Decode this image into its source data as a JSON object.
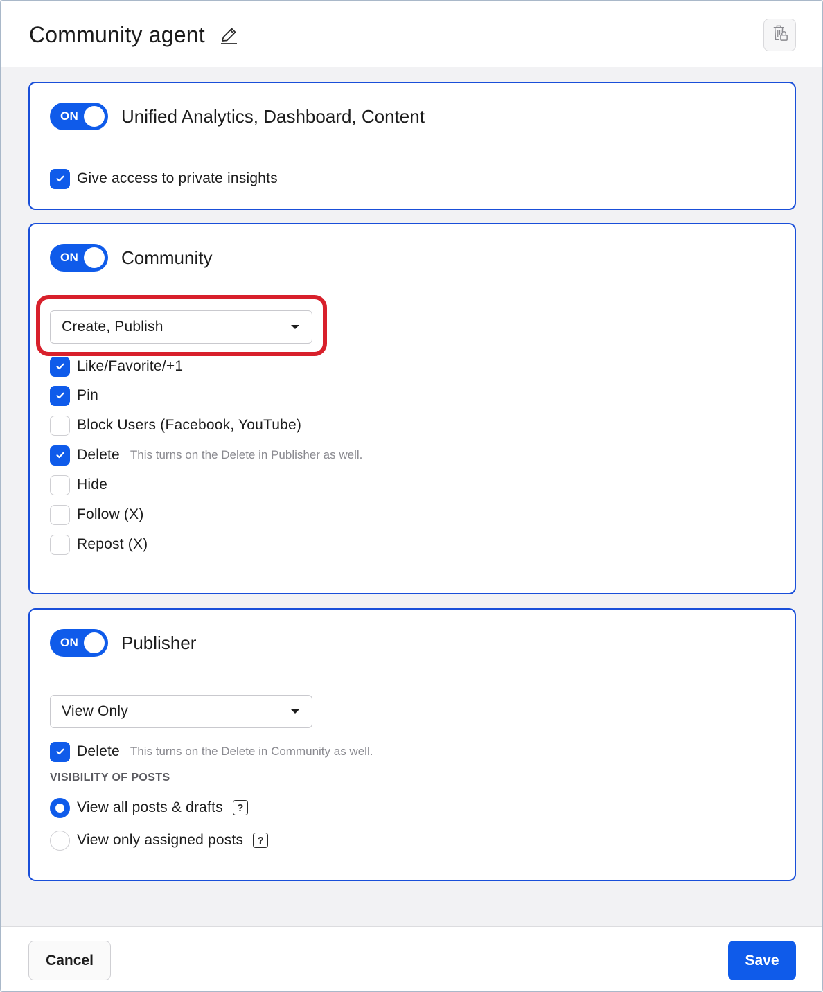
{
  "header": {
    "title": "Community agent",
    "edit_icon": "pencil-icon",
    "action_icon": "delete-lock-icon"
  },
  "sections": {
    "analytics": {
      "toggle_label": "ON",
      "title": "Unified Analytics, Dashboard, Content",
      "checkboxes": [
        {
          "label": "Give access to private insights",
          "checked": true
        }
      ]
    },
    "community": {
      "toggle_label": "ON",
      "title": "Community",
      "select_value": "Create, Publish",
      "checkboxes": [
        {
          "label": "Like/Favorite/+1",
          "checked": true,
          "hint": ""
        },
        {
          "label": "Pin",
          "checked": true,
          "hint": ""
        },
        {
          "label": "Block Users (Facebook, YouTube)",
          "checked": false,
          "hint": ""
        },
        {
          "label": "Delete",
          "checked": true,
          "hint": "This turns on the Delete in Publisher as well."
        },
        {
          "label": "Hide",
          "checked": false,
          "hint": ""
        },
        {
          "label": "Follow (X)",
          "checked": false,
          "hint": ""
        },
        {
          "label": "Repost (X)",
          "checked": false,
          "hint": ""
        }
      ]
    },
    "publisher": {
      "toggle_label": "ON",
      "title": "Publisher",
      "select_value": "View Only",
      "checkboxes": [
        {
          "label": "Delete",
          "checked": true,
          "hint": "This turns on the Delete in Community as well."
        }
      ],
      "visibility_heading": "VISIBILITY OF POSTS",
      "radios": [
        {
          "label": "View all posts & drafts",
          "selected": true,
          "help": "?"
        },
        {
          "label": "View only assigned posts",
          "selected": false,
          "help": "?"
        }
      ]
    }
  },
  "footer": {
    "cancel_label": "Cancel",
    "save_label": "Save"
  },
  "colors": {
    "accent": "#0f5bea",
    "card_border": "#1a4fd9",
    "highlight": "#d8202b"
  }
}
